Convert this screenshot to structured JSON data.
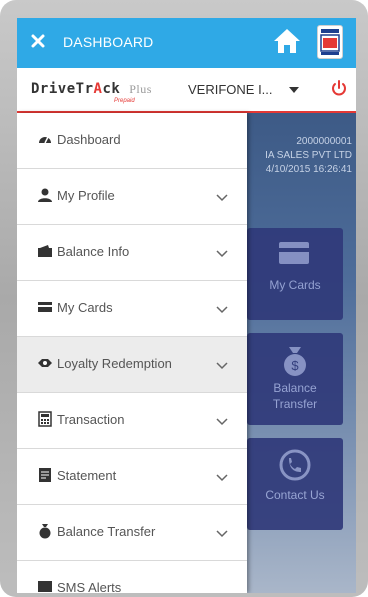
{
  "topbar": {
    "title": "DASHBOARD",
    "accent_color": "#2fa9e6",
    "icons": [
      "close-icon",
      "home-icon",
      "brand-badge-icon"
    ]
  },
  "account": {
    "logo_text_main": "DriveTr",
    "logo_text_accent": "A",
    "logo_text_end": "ck",
    "logo_plus": "Plus",
    "logo_sub": "Prepaid",
    "device_select_value": "VERIFONE I...",
    "accent_color": "#e53935"
  },
  "dashboard": {
    "info_lines": [
      "2000000001",
      "IA SALES PVT LTD",
      "4/10/2015 16:26:41"
    ],
    "tiles": [
      {
        "label_lines": [
          "My Cards"
        ],
        "icon": "card-icon"
      },
      {
        "label_lines": [
          "Balance",
          "Transfer"
        ],
        "icon": "money-bag-icon"
      },
      {
        "label_lines": [
          "Contact Us"
        ],
        "icon": "phone-icon"
      }
    ],
    "tile_color": "#303a7a"
  },
  "drawer": {
    "items": [
      {
        "label": "Dashboard",
        "icon": "dashboard-gauge-icon",
        "has_chevron": false,
        "highlight": false
      },
      {
        "label": "My Profile",
        "icon": "user-icon",
        "has_chevron": true,
        "highlight": false
      },
      {
        "label": "Balance Info",
        "icon": "balance-info-icon",
        "has_chevron": true,
        "highlight": false
      },
      {
        "label": "My Cards",
        "icon": "card-icon",
        "has_chevron": true,
        "highlight": false
      },
      {
        "label": "Loyalty Redemption",
        "icon": "loyalty-icon",
        "has_chevron": true,
        "highlight": true
      },
      {
        "label": "Transaction",
        "icon": "transaction-icon",
        "has_chevron": true,
        "highlight": false
      },
      {
        "label": "Statement",
        "icon": "statement-icon",
        "has_chevron": true,
        "highlight": false
      },
      {
        "label": "Balance Transfer",
        "icon": "money-bag-icon",
        "has_chevron": true,
        "highlight": false
      },
      {
        "label": "SMS Alerts",
        "icon": "sms-icon",
        "has_chevron": false,
        "highlight": false
      }
    ]
  }
}
